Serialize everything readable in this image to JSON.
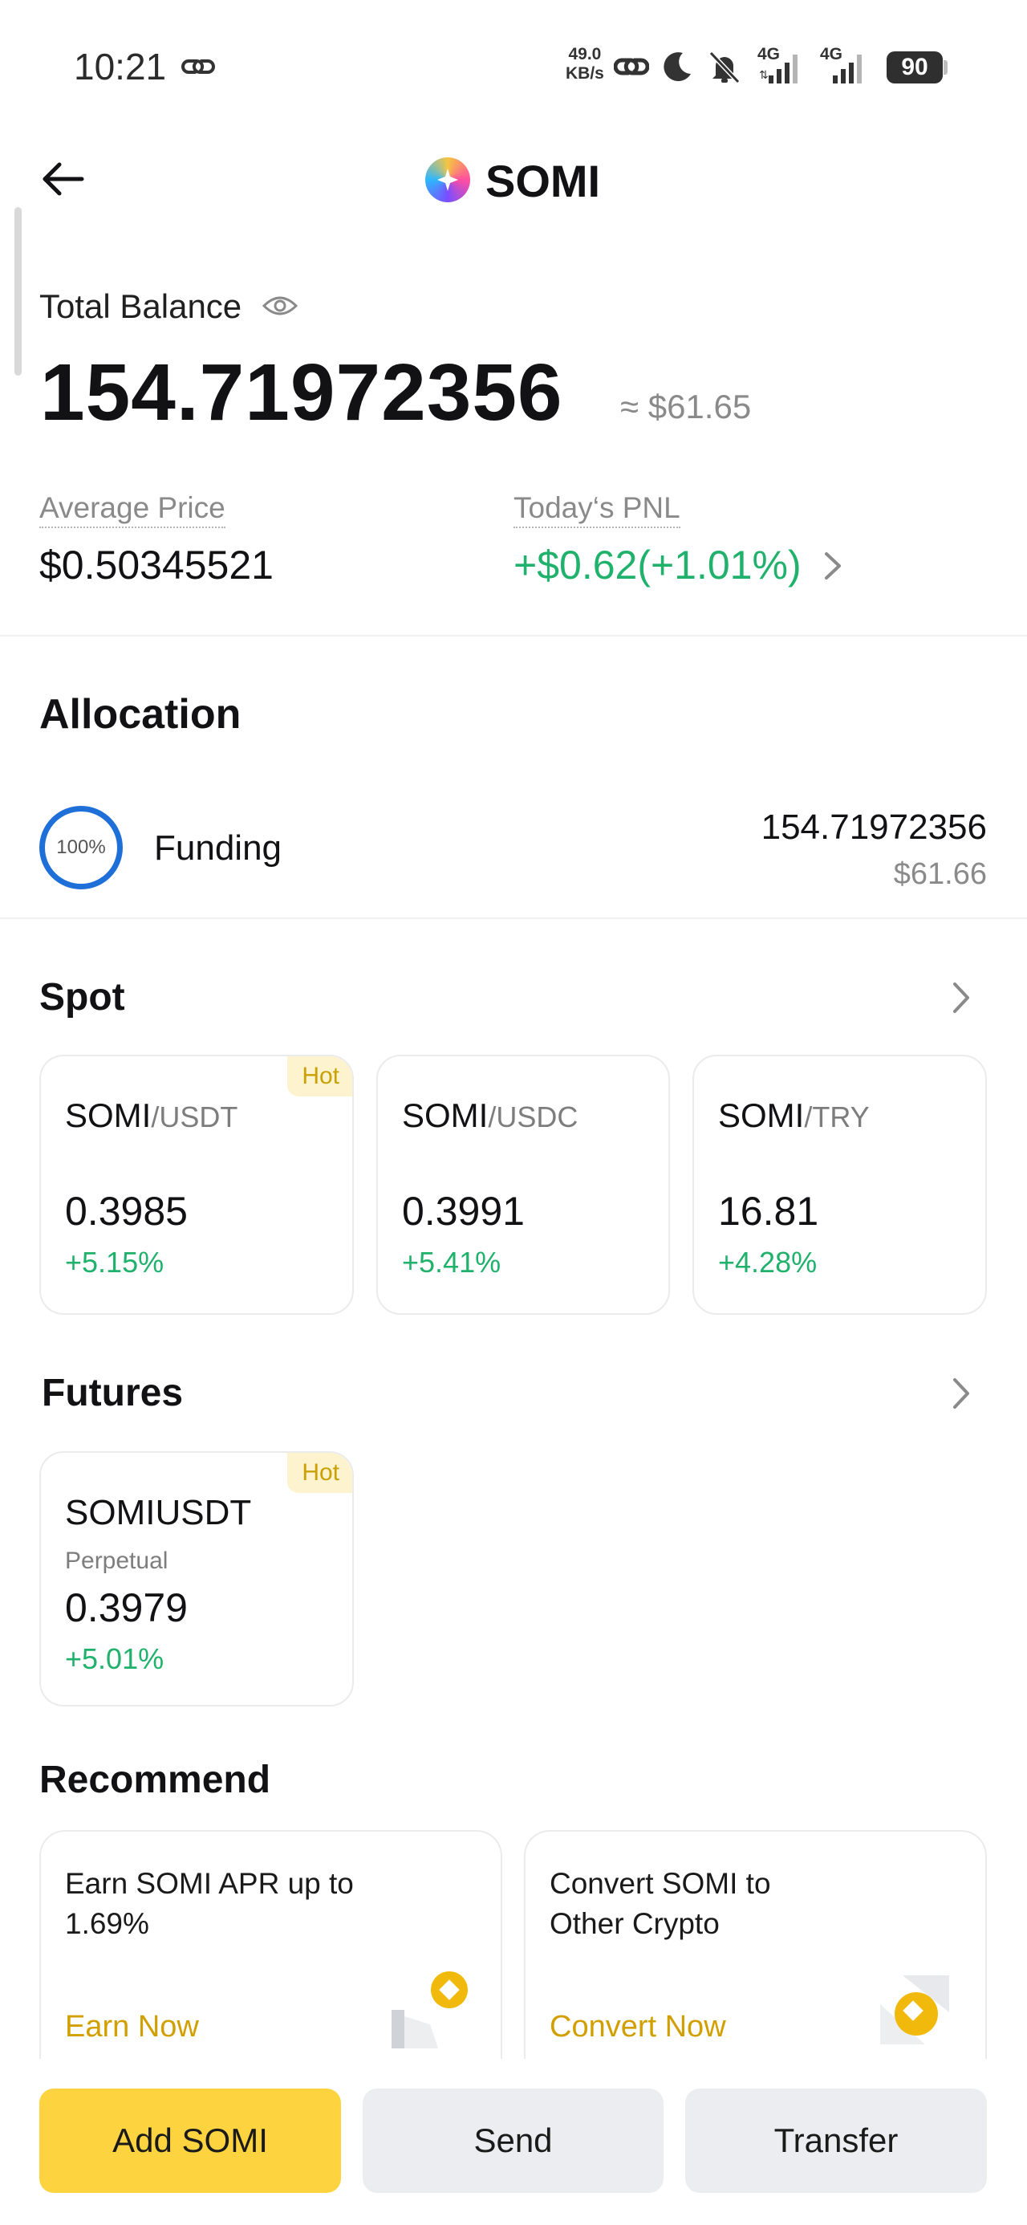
{
  "status_bar": {
    "time": "10:21",
    "net_speed_value": "49.0",
    "net_speed_unit": "KB/s",
    "network_1": "4G",
    "network_2": "4G",
    "battery": "90"
  },
  "header": {
    "title": "SOMI",
    "back_icon": "arrow-left-icon",
    "logo_icon": "somi-logo-icon"
  },
  "balance": {
    "label": "Total Balance",
    "amount": "154.71972356",
    "usd": "≈ $61.65",
    "avg_price_label": "Average Price",
    "avg_price_value": "$0.50345521",
    "pnl_label": "Today‘s PNL",
    "pnl_value": "+$0.62(+1.01%)"
  },
  "allocation": {
    "title": "Allocation",
    "items": [
      {
        "percent": "100%",
        "percent_value": 100,
        "label": "Funding",
        "amount": "154.71972356",
        "usd": "$61.66"
      }
    ]
  },
  "spot": {
    "title": "Spot",
    "cards": [
      {
        "base": "SOMI",
        "quote": "/USDT",
        "price": "0.3985",
        "change": "+5.15%",
        "badge": "Hot"
      },
      {
        "base": "SOMI",
        "quote": "/USDC",
        "price": "0.3991",
        "change": "+5.41%"
      },
      {
        "base": "SOMI",
        "quote": "/TRY",
        "price": "16.81",
        "change": "+4.28%"
      }
    ]
  },
  "futures": {
    "title": "Futures",
    "cards": [
      {
        "name": "SOMIUSDT",
        "type": "Perpetual",
        "price": "0.3979",
        "change": "+5.01%",
        "badge": "Hot"
      }
    ]
  },
  "recommend": {
    "title": "Recommend",
    "cards": [
      {
        "line1": "Earn SOMI APR up to",
        "line2": "1.69%",
        "action": "Earn Now"
      },
      {
        "line1": "Convert SOMI to",
        "line2": "Other Crypto",
        "action": "Convert Now"
      }
    ]
  },
  "bottom_actions": {
    "add": "Add SOMI",
    "send": "Send",
    "transfer": "Transfer"
  },
  "colors": {
    "accent_yellow": "#fdd33f",
    "positive": "#20b26c",
    "ring_blue": "#1f6fd9"
  }
}
